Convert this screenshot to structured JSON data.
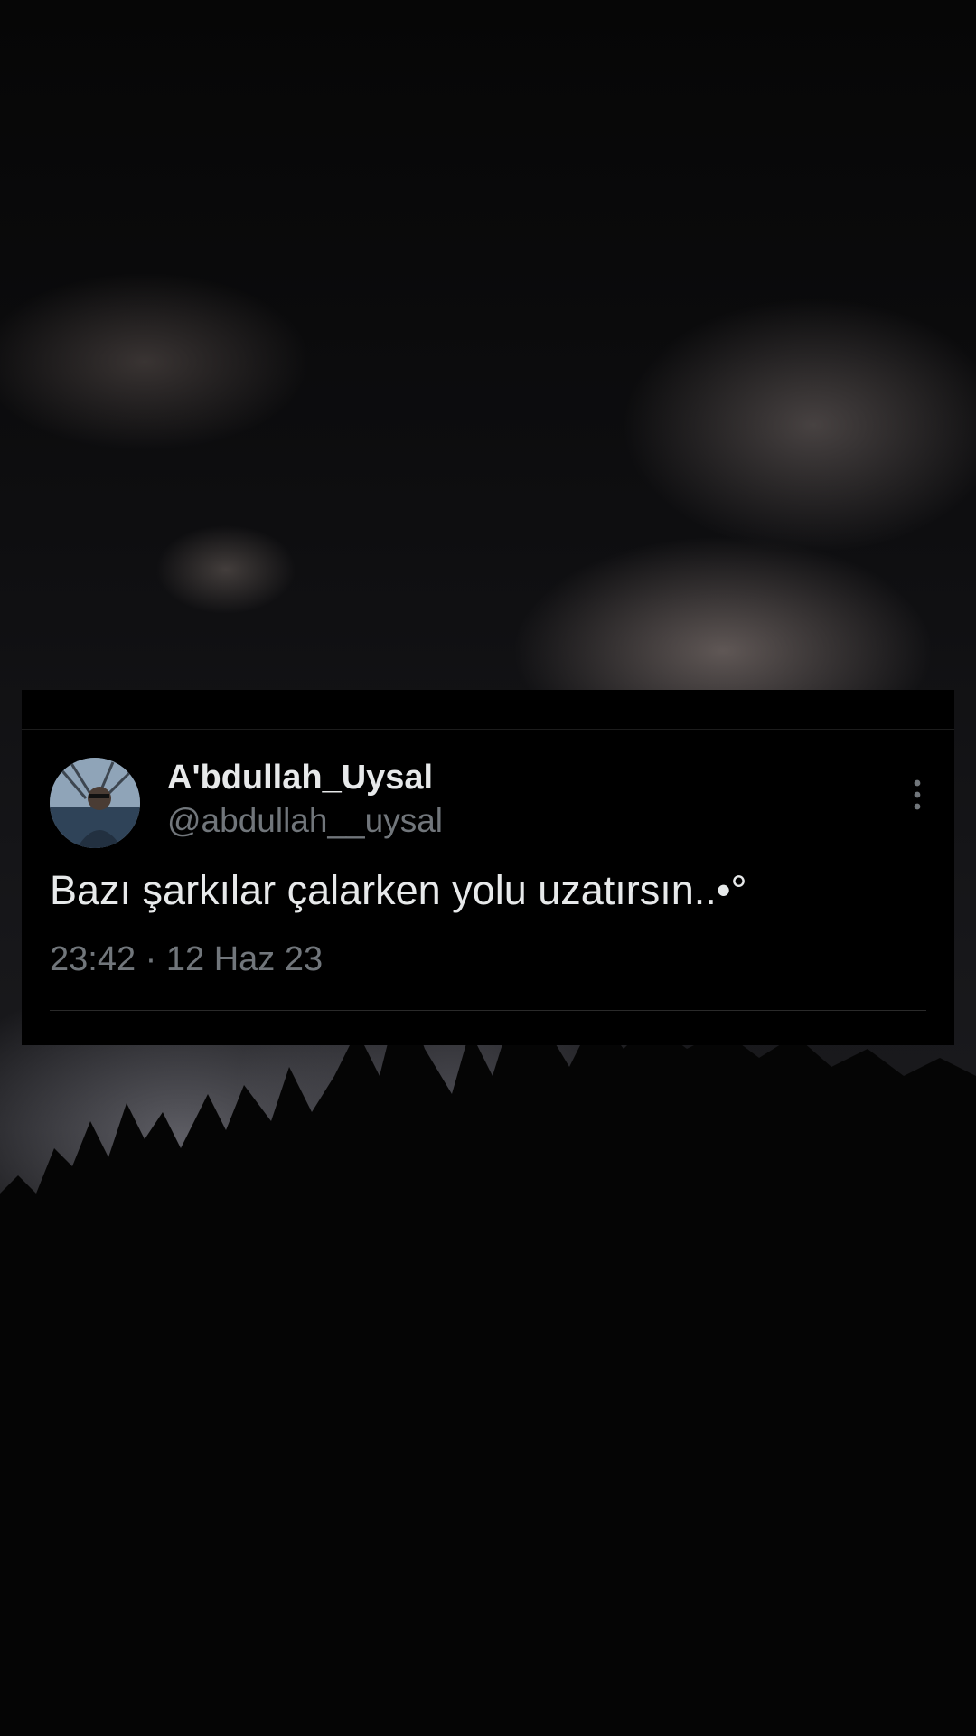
{
  "tweet": {
    "display_name": "A'bdullah_Uysal",
    "handle": "@abdullah__uysal",
    "text": "Bazı şarkılar çalarken yolu uzatırsın..•°",
    "time": "23:42",
    "separator": "·",
    "date": "12 Haz 23",
    "more_icon": "more-vertical-icon",
    "avatar_icon": "avatar-photo"
  },
  "colors": {
    "card_background": "#000000",
    "name_color": "#e7e9ea",
    "secondary_text": "#71767b"
  }
}
